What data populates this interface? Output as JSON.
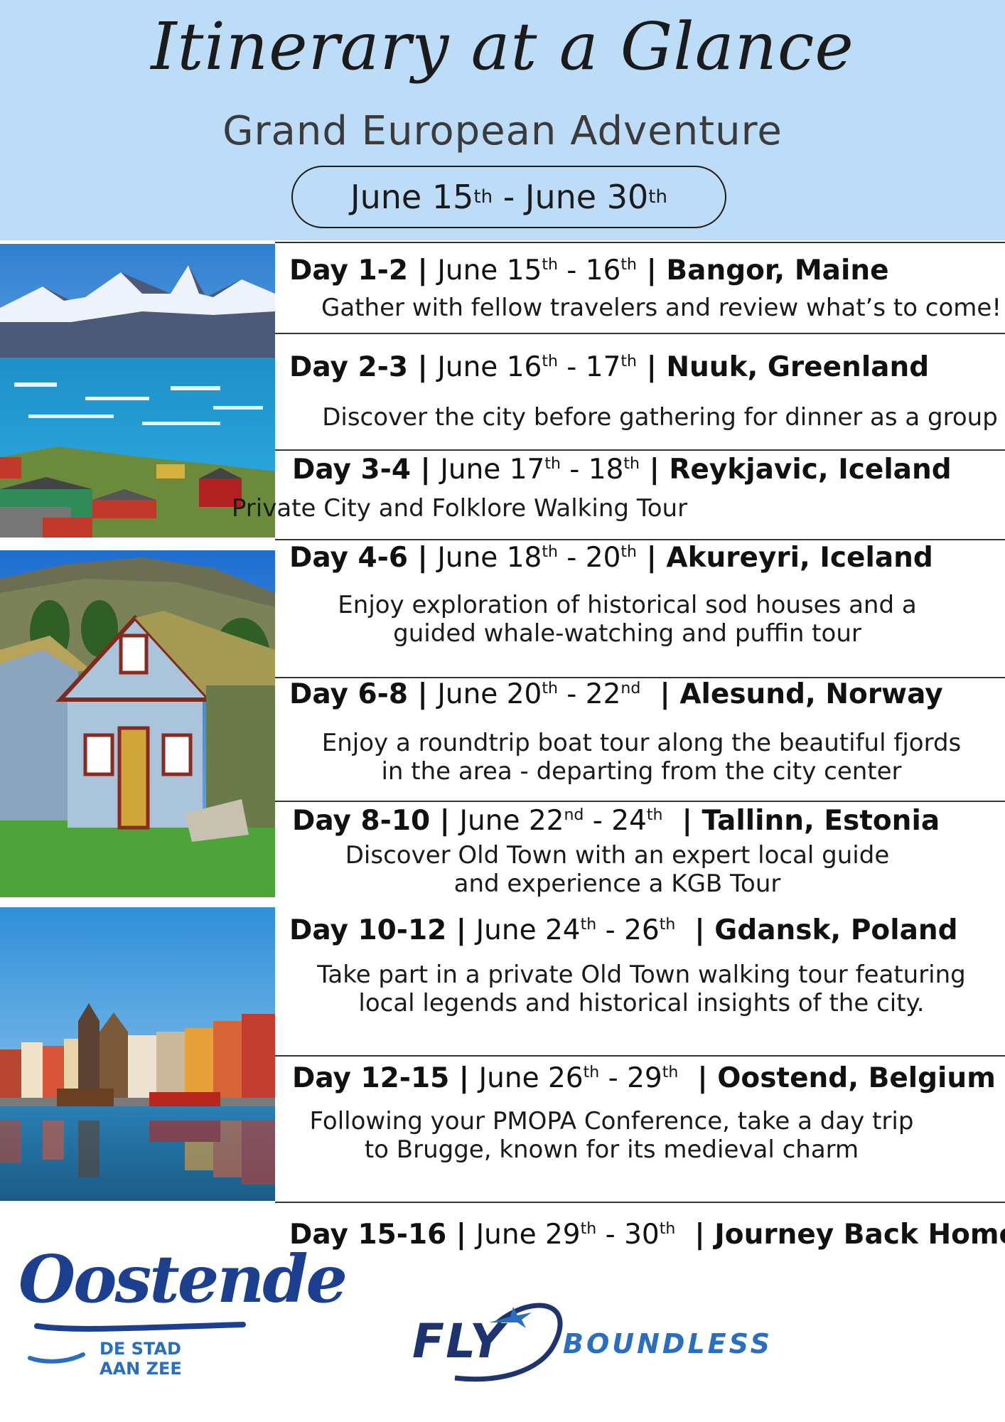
{
  "header": {
    "script_title": "Itinerary at a Glance",
    "subtitle": "Grand European Adventure",
    "date_range": {
      "start_month": "June",
      "start_day": "15",
      "start_suffix": "th",
      "sep": " - ",
      "end_month": "June",
      "end_day": "30",
      "end_suffix": "th"
    }
  },
  "itinerary": [
    {
      "days": "Day 1-2",
      "d1": "June 15",
      "s1": "th",
      "d2": "16",
      "s2": "th",
      "place": "Bangor, Maine",
      "desc1": "Gather with fellow travelers and review what’s to come!",
      "desc2": ""
    },
    {
      "days": "Day 2-3",
      "d1": "June 16",
      "s1": "th",
      "d2": "17",
      "s2": "th",
      "place": "Nuuk, Greenland",
      "desc1": "Discover the city before gathering for dinner as a group",
      "desc2": ""
    },
    {
      "days": "Day 3-4",
      "d1": "June 17",
      "s1": "th",
      "d2": "18",
      "s2": "th",
      "place": "Reykjavic, Iceland",
      "desc1": "Private City and Folklore Walking Tour",
      "desc2": ""
    },
    {
      "days": "Day 4-6",
      "d1": "June 18",
      "s1": "th",
      "d2": "20",
      "s2": "th",
      "place": "Akureyri, Iceland",
      "desc1": "Enjoy exploration of historical sod houses and a",
      "desc2": "guided whale-watching and puffin tour"
    },
    {
      "days": "Day 6-8",
      "d1": "June 20",
      "s1": "th",
      "d2": "22",
      "s2": "nd",
      "place": "Alesund, Norway",
      "desc1": "Enjoy a roundtrip boat tour along the beautiful fjords",
      "desc2": "in the area - departing from the city center"
    },
    {
      "days": "Day 8-10",
      "d1": "June 22",
      "s1": "nd",
      "d2": "24",
      "s2": "th",
      "place": "Tallinn, Estonia",
      "desc1": "Discover Old Town with an expert local guide",
      "desc2": "and experience a KGB Tour"
    },
    {
      "days": "Day 10-12",
      "d1": "June 24",
      "s1": "th",
      "d2": "26",
      "s2": "th",
      "place": "Gdansk, Poland",
      "desc1": "Take part in a private Old Town walking tour featuring",
      "desc2": "local legends and historical insights of the city."
    },
    {
      "days": "Day 12-15",
      "d1": "June 26",
      "s1": "th",
      "d2": "29",
      "s2": "th",
      "place": "Oostend, Belgium",
      "desc1": "Following your PMOPA Conference, take a day trip",
      "desc2": "to Brugge, known for its medieval charm"
    },
    {
      "days": "Day 15-16",
      "d1": "June 29",
      "s1": "th",
      "d2": "30",
      "s2": "th",
      "place": "Journey Back Home",
      "desc1": "",
      "desc2": ""
    }
  ],
  "logos": {
    "oostende": {
      "word": "Oostende",
      "line1": "DE STAD",
      "line2": "AAN ZEE"
    },
    "flyboundless": {
      "fly": "FLY",
      "boundless": "BOUNDLESS"
    }
  },
  "colors": {
    "header_bg": "#bcdcf7",
    "logo_navy": "#1d3470",
    "logo_blue": "#2a6fbf"
  }
}
